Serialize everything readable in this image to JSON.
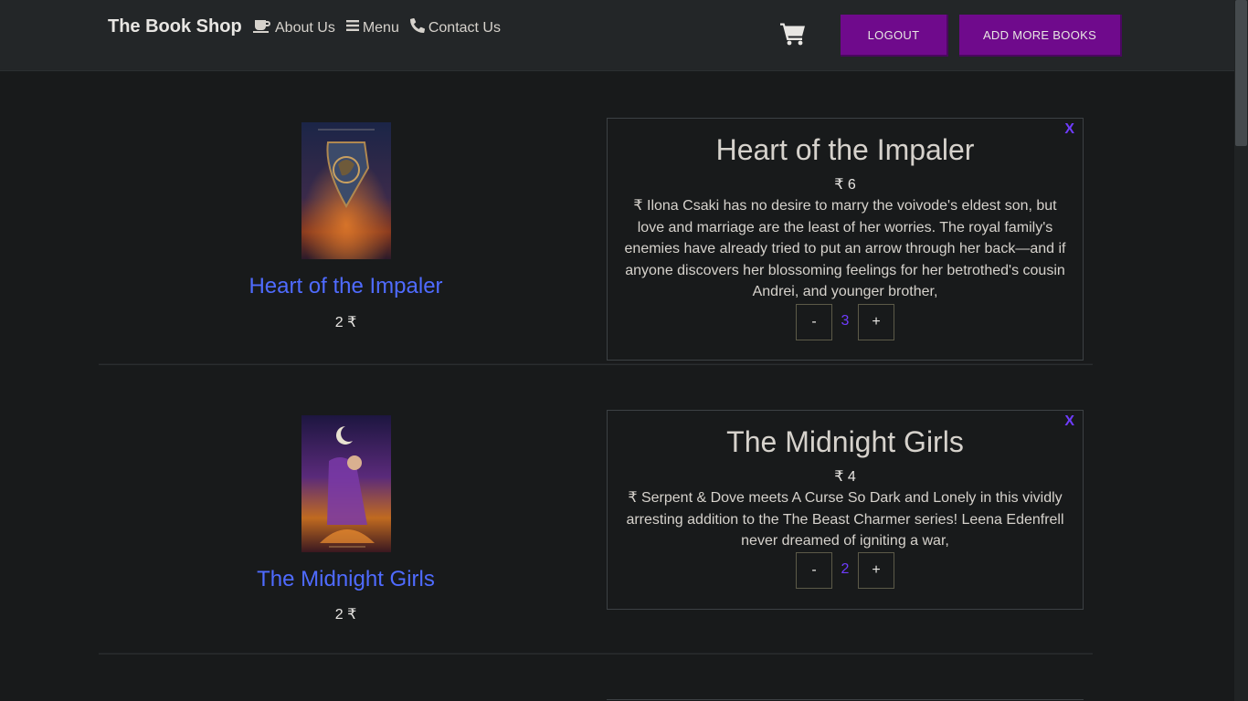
{
  "navbar": {
    "brand": "The Book Shop",
    "links": [
      {
        "label": "About Us",
        "icon": "coffee-icon"
      },
      {
        "label": "Menu",
        "icon": "bars-icon"
      },
      {
        "label": "Contact Us",
        "icon": "phone-icon"
      }
    ],
    "cart_icon": "cart-icon",
    "logout_label": "LOGOUT",
    "add_books_label": "ADD MORE BOOKS",
    "accent_color": "#6f0a8c"
  },
  "books": [
    {
      "cover_title": "Heart of the Impaler",
      "cover_price": "2 ₹",
      "card_title": "Heart of the Impaler",
      "card_price": "₹ 6",
      "description": "₹ Ilona Csaki has no desire to marry the voivode's eldest son, but love and marriage are the least of her worries. The royal family's enemies have already tried to put an arrow through her back—and if anyone discovers her blossoming feelings for her betrothed's cousin Andrei, and younger brother,",
      "minus_label": "-",
      "plus_label": "+",
      "quantity": "3",
      "close_label": "X"
    },
    {
      "cover_title": "The Midnight Girls",
      "cover_price": "2 ₹",
      "card_title": "The Midnight Girls",
      "card_price": "₹ 4",
      "description": "₹ Serpent & Dove meets A Curse So Dark and Lonely in this vividly arresting addition to the The Beast Charmer series! Leena Edenfrell never dreamed of igniting a war,",
      "minus_label": "-",
      "plus_label": "+",
      "quantity": "2",
      "close_label": "X"
    }
  ]
}
